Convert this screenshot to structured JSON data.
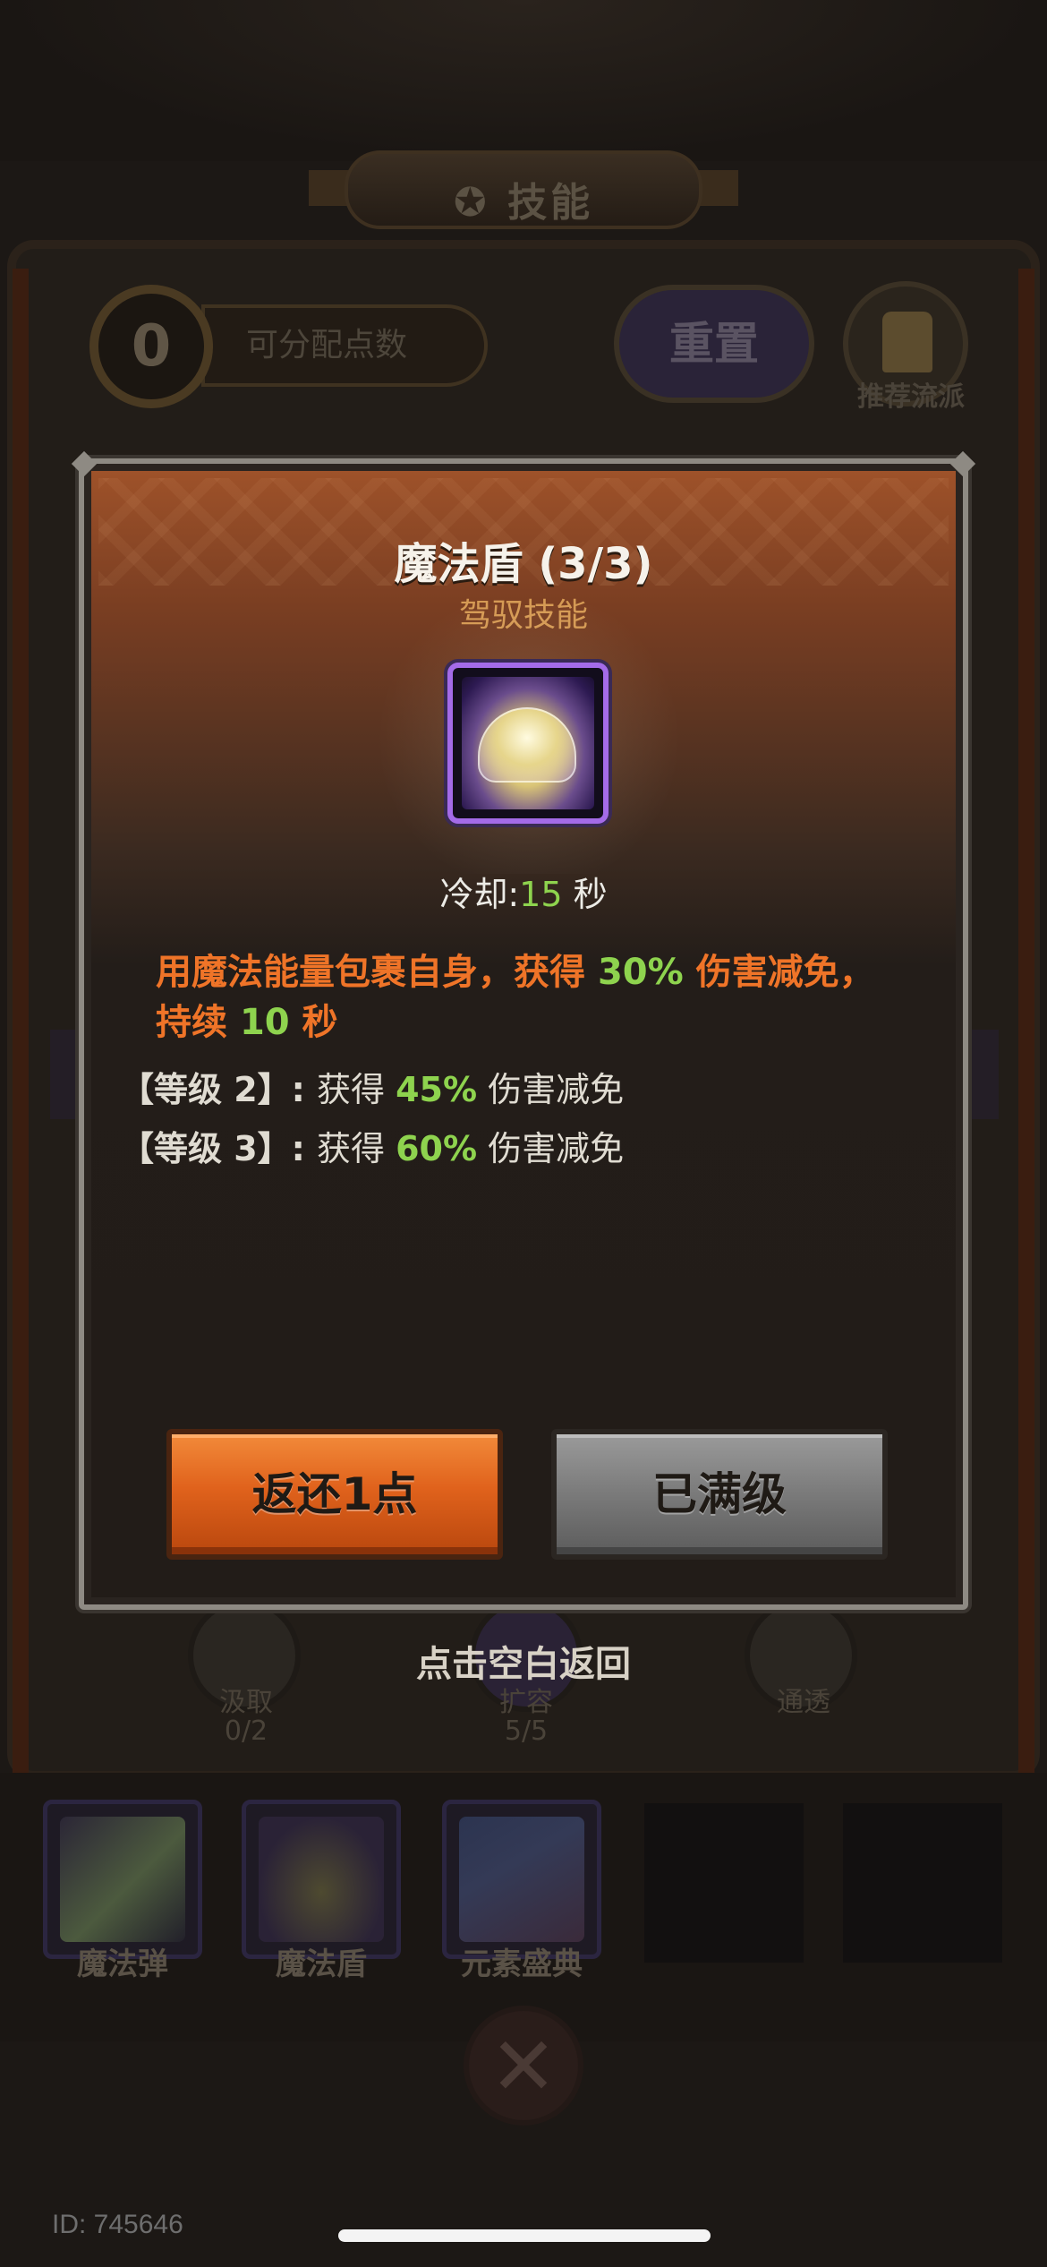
{
  "background": {
    "title": "技能",
    "points": {
      "value": "0",
      "label": "可分配点数"
    },
    "reset_label": "重置",
    "recommend_label": "推荐流派",
    "tree_nodes": [
      {
        "name": "汲取",
        "count": "0/2"
      },
      {
        "name": "扩容",
        "count": "5/5"
      },
      {
        "name": "通透",
        "count": ""
      }
    ],
    "tap_return": "点击空白返回",
    "equipped_skills": [
      "魔法弹",
      "魔法盾",
      "元素盛典"
    ],
    "player_id": "ID: 745646"
  },
  "modal": {
    "skill_name": "魔法盾 (3/3)",
    "skill_type": "驾驭技能",
    "icon": "magic-shield-icon",
    "cooldown": {
      "prefix": "冷却:",
      "value": "15",
      "suffix": " 秒"
    },
    "description": {
      "part1": "用魔法能量包裹自身，获得 ",
      "value1": "30%",
      "part2": " 伤害减免，持续 ",
      "value2": "10",
      "part3": " 秒"
    },
    "levels": [
      {
        "label": "【等级 2】:",
        "prefix": "获得 ",
        "value": "45%",
        "suffix": " 伤害减免"
      },
      {
        "label": "【等级 3】:",
        "prefix": "获得 ",
        "value": "60%",
        "suffix": " 伤害减免"
      }
    ],
    "return_button": "返还1点",
    "maxed_button": "已满级"
  },
  "colors": {
    "accent_orange": "#ef7428",
    "highlight_green": "#8ed34e",
    "icon_border_purple": "#a46be8"
  }
}
